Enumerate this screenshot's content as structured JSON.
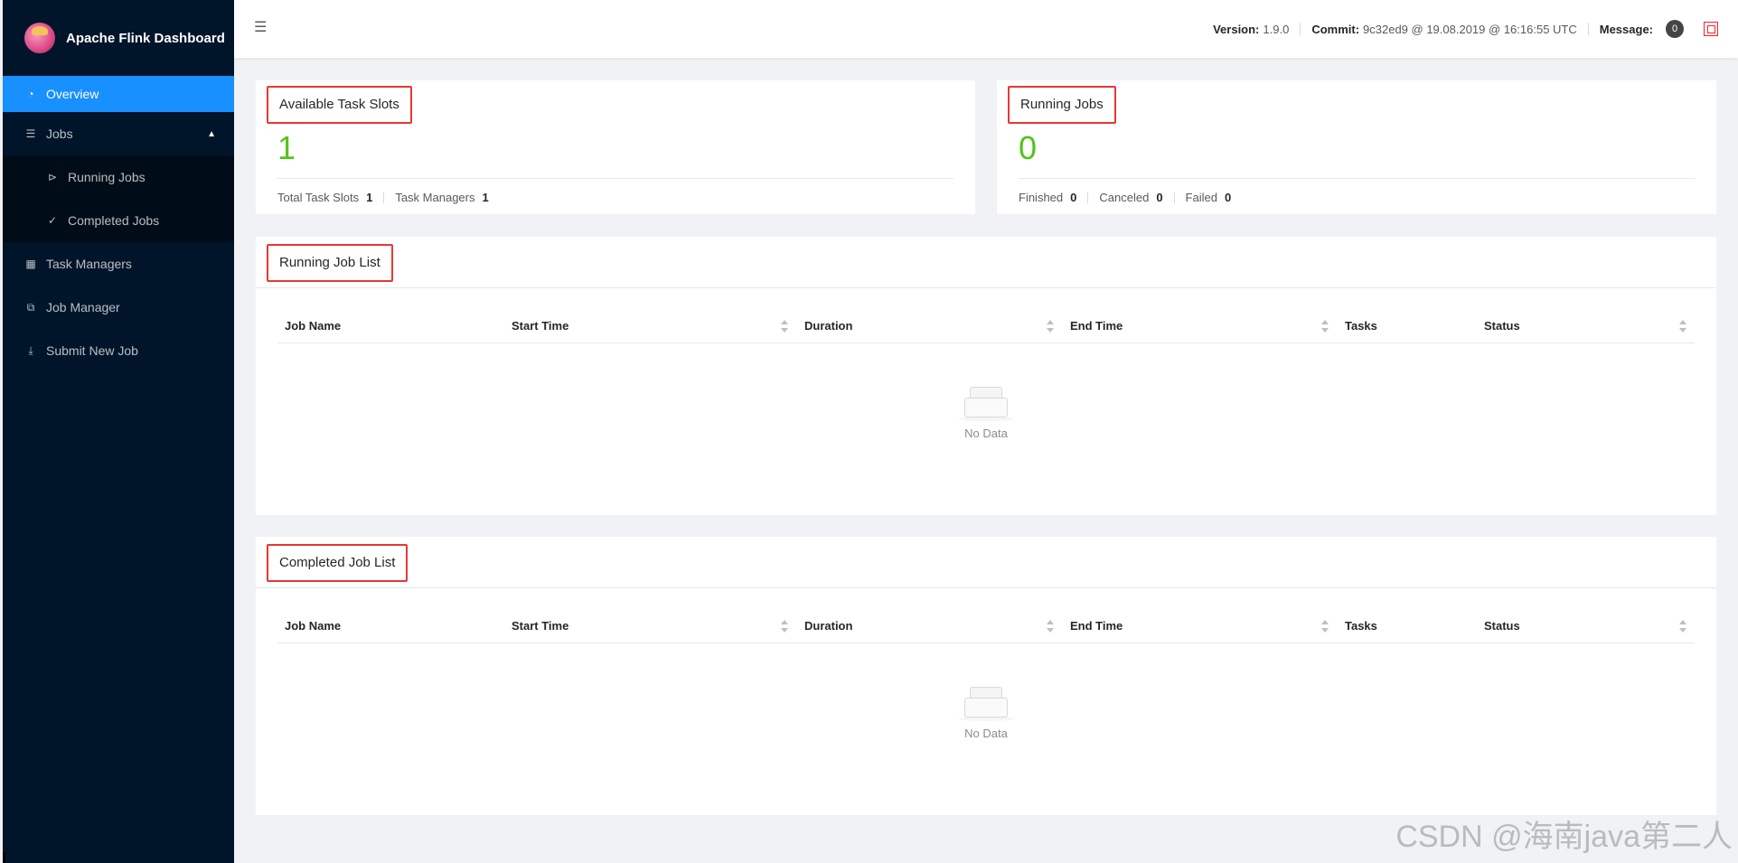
{
  "app": {
    "title": "Apache Flink Dashboard"
  },
  "sidebar": {
    "items": [
      {
        "label": "Overview",
        "icon": "dashboard-icon"
      },
      {
        "label": "Jobs",
        "icon": "list-icon"
      },
      {
        "label": "Running Jobs",
        "icon": "play-circle-icon"
      },
      {
        "label": "Completed Jobs",
        "icon": "check-circle-icon"
      },
      {
        "label": "Task Managers",
        "icon": "schedule-icon"
      },
      {
        "label": "Job Manager",
        "icon": "cluster-icon"
      },
      {
        "label": "Submit New Job",
        "icon": "upload-icon"
      }
    ]
  },
  "header": {
    "version_label": "Version:",
    "version_value": "1.9.0",
    "commit_label": "Commit:",
    "commit_value": "9c32ed9 @ 19.08.2019 @ 16:16:55 UTC",
    "message_label": "Message:",
    "message_count": "0"
  },
  "slots_card": {
    "title": "Available Task Slots",
    "value": "1",
    "total_label": "Total Task Slots",
    "total_value": "1",
    "tm_label": "Task Managers",
    "tm_value": "1"
  },
  "jobs_card": {
    "title": "Running Jobs",
    "value": "0",
    "finished_label": "Finished",
    "finished_value": "0",
    "canceled_label": "Canceled",
    "canceled_value": "0",
    "failed_label": "Failed",
    "failed_value": "0"
  },
  "running_list": {
    "title": "Running Job List",
    "columns": [
      "Job Name",
      "Start Time",
      "Duration",
      "End Time",
      "Tasks",
      "Status"
    ],
    "empty_text": "No Data"
  },
  "completed_list": {
    "title": "Completed Job List",
    "columns": [
      "Job Name",
      "Start Time",
      "Duration",
      "End Time",
      "Tasks",
      "Status"
    ],
    "empty_text": "No Data"
  },
  "watermark": "CSDN @海南java第二人",
  "colors": {
    "sidebar_bg": "#001529",
    "active": "#1890ff",
    "success": "#52c41a",
    "highlight_border": "#e53935"
  }
}
